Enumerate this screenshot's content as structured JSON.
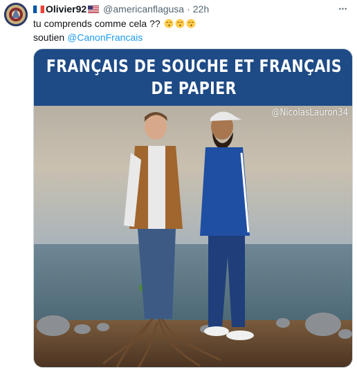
{
  "tweet": {
    "display_name": "Olivier92",
    "handle": "@americanflagusa",
    "separator": "·",
    "time": "22h",
    "more_label": "•••",
    "text_line1": "tu comprends comme cela ??",
    "text_line2_prefix": "soutien",
    "mention": "@CanonFrancais",
    "emojis": [
      "face-kissing-emoji",
      "face-kissing-emoji",
      "face-kissing-emoji"
    ],
    "flags": [
      "france-flag-icon",
      "usa-flag-icon"
    ]
  },
  "media": {
    "banner_line1": "FRANÇAIS DE SOUCHE ET FRANÇAIS",
    "banner_line2": "DE PAPIER",
    "watermark": "@NicolasLauron34"
  },
  "colors": {
    "link": "#1d9bf0",
    "secondary_text": "#536471",
    "banner_bg": "#1e4a86"
  }
}
